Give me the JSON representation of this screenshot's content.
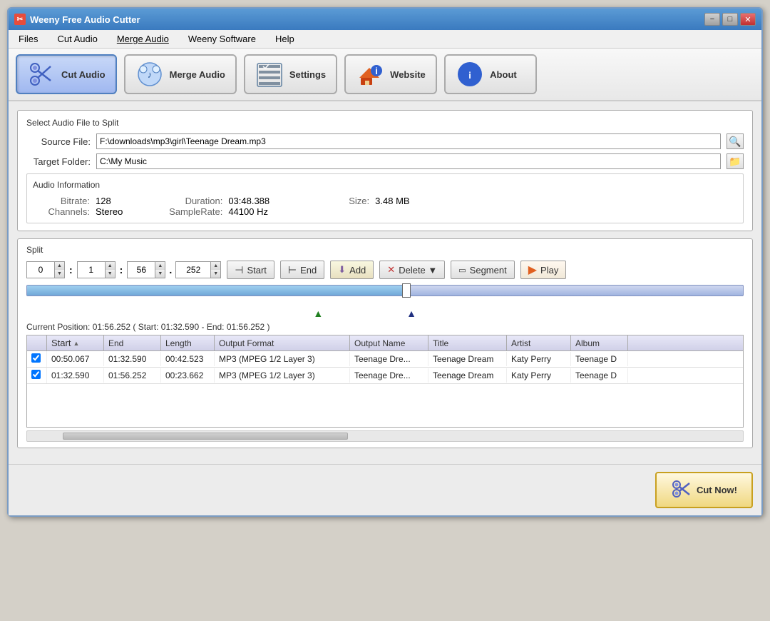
{
  "window": {
    "title": "Weeny Free Audio Cutter",
    "controls": [
      "−",
      "□",
      "✕"
    ]
  },
  "menubar": {
    "items": [
      "Files",
      "Cut Audio",
      "Merge Audio",
      "Weeny Software",
      "Help"
    ]
  },
  "toolbar": {
    "buttons": [
      {
        "id": "cut-audio",
        "label": "Cut Audio",
        "active": true
      },
      {
        "id": "merge-audio",
        "label": "Merge Audio",
        "active": false
      },
      {
        "id": "settings",
        "label": "Settings",
        "active": false
      },
      {
        "id": "website",
        "label": "Website",
        "active": false
      },
      {
        "id": "about",
        "label": "About",
        "active": false
      }
    ]
  },
  "file_section": {
    "title": "Select Audio File to Split",
    "source_label": "Source File:",
    "source_value": "F:\\downloads\\mp3\\girl\\Teenage Dream.mp3",
    "target_label": "Target Folder:",
    "target_value": "C:\\My Music"
  },
  "audio_info": {
    "title": "Audio Information",
    "bitrate_label": "Bitrate:",
    "bitrate_value": "128",
    "duration_label": "Duration:",
    "duration_value": "03:48.388",
    "size_label": "Size:",
    "size_value": "3.48 MB",
    "channels_label": "Channels:",
    "channels_value": "Stereo",
    "samplerate_label": "SampleRate:",
    "samplerate_value": "44100 Hz"
  },
  "split_section": {
    "title": "Split",
    "fields": [
      "0",
      "1",
      "56",
      "252"
    ],
    "buttons": [
      "Start",
      "End",
      "Add",
      "Delete",
      "Segment",
      "Play"
    ]
  },
  "position": {
    "text": "Current Position: 01:56.252 ( Start: 01:32.590 - End: 01:56.252 )"
  },
  "table": {
    "columns": [
      "",
      "Start",
      "End",
      "Length",
      "Output Format",
      "Output Name",
      "Title",
      "Artist",
      "Album"
    ],
    "rows": [
      {
        "checked": true,
        "start": "00:50.067",
        "end": "01:32.590",
        "length": "00:42.523",
        "format": "MP3 (MPEG 1/2 Layer 3)",
        "output_name": "Teenage Dre...",
        "title": "Teenage Dream",
        "artist": "Katy Perry",
        "album": "Teenage D"
      },
      {
        "checked": true,
        "start": "01:32.590",
        "end": "01:56.252",
        "length": "00:23.662",
        "format": "MP3 (MPEG 1/2 Layer 3)",
        "output_name": "Teenage Dre...",
        "title": "Teenage Dream",
        "artist": "Katy Perry",
        "album": "Teenage D"
      }
    ]
  },
  "cut_now_label": "Cut Now!"
}
